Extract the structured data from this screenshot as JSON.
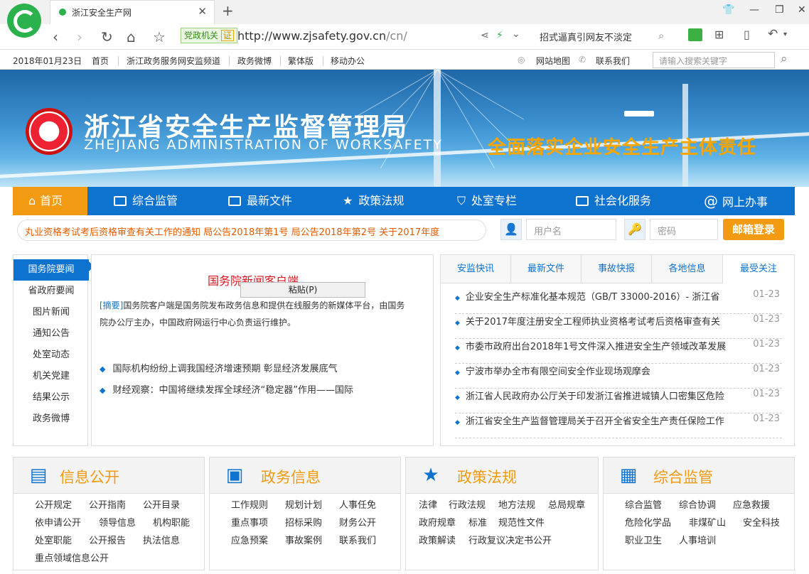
{
  "browser": {
    "tab_title": "浙江安全生产网",
    "badge": "党政机关",
    "badge_mark": "证",
    "url_main": "http://www.zjsafety.gov.cn",
    "url_rest": "/cn/",
    "hint_text": "招式逼真引网友不淡定"
  },
  "util": {
    "date": "2018年01月23日",
    "links": [
      "首页",
      "浙江政务服务网安监频道",
      "政务微博",
      "繁体版",
      "移动办公"
    ],
    "sitemap": "网站地图",
    "contact": "联系我们",
    "search_placeholder": "请输入搜索关键字"
  },
  "banner": {
    "title": "浙江省安全生产监督管理局",
    "title_en": "ZHEJIANG ADMINISTRATION OF WORKSAFETY",
    "slogan": "全面落实企业安全生产主体责任"
  },
  "nav": [
    "首页",
    "综合监管",
    "最新文件",
    "政策法规",
    "处室专栏",
    "社会化服务",
    "网上办事"
  ],
  "ticker": "丸业资格考试考后资格审查有关工作的通知   局公告2018年第1号   局公告2018年第2号   关于2017年度",
  "login": {
    "user_placeholder": "用户名",
    "pass_placeholder": "密码",
    "button": "邮箱登录"
  },
  "left_menu": [
    "国务院要闻",
    "省政府要闻",
    "图片新闻",
    "通知公告",
    "处室动态",
    "机关党建",
    "结果公示",
    "政务微博"
  ],
  "center": {
    "title": "国务院新闻客户端",
    "context_menu": "粘贴(P)",
    "abstract_tag": "[摘要]",
    "abstract": "国务院客户端是国务院发布政务信息和提供在线服务的新媒体平台，由国务院办公厅主办，中国政府网运行中心负责运行维护。",
    "items": [
      "国际机构纷纷上调我国经济增速预期 彰显经济发展底气",
      "财经观察：中国将继续发挥全球经济“稳定器”作用——国际"
    ]
  },
  "right": {
    "tabs": [
      "安监快讯",
      "最新文件",
      "事故快报",
      "各地信息",
      "最受关注"
    ],
    "items": [
      {
        "title": "企业安全生产标准化基本规范（GB/T 33000-2016）- 浙江省",
        "date": "01-23"
      },
      {
        "title": "关于2017年度注册安全工程师执业资格考试考后资格审查有关",
        "date": "01-23"
      },
      {
        "title": "市委市政府出台2018年1号文件深入推进安全生产领域改革发展",
        "date": "01-23"
      },
      {
        "title": "宁波市举办全市有限空间安全作业现场观摩会",
        "date": "01-23"
      },
      {
        "title": "浙江省人民政府办公厅关于印发浙江省推进城镇人口密集区危险",
        "date": "01-23"
      },
      {
        "title": "浙江省安全生产监督管理局关于召开全省安全生产责任保险工作",
        "date": "01-23"
      }
    ]
  },
  "sections": [
    {
      "title": "信息公开",
      "links": [
        "公开规定",
        "公开指南",
        "公开目录",
        "依申请公开",
        "领导信息",
        "机构职能",
        "处室职能",
        "公开报告",
        "执法信息",
        "重点领域信息公开"
      ]
    },
    {
      "title": "政务信息",
      "links": [
        "工作规则",
        "规划计划",
        "人事任免",
        "重点事项",
        "招标采购",
        "财务公开",
        "应急预案",
        "事故案例",
        "联系我们"
      ]
    },
    {
      "title": "政策法规",
      "links": [
        "法律",
        "行政法规",
        "地方法规",
        "总局规章",
        "政府规章",
        "标准",
        "规范性文件",
        "政策解读",
        "行政复议决定书公开"
      ]
    },
    {
      "title": "综合监管",
      "links": [
        "综合监管",
        "综合协调",
        "应急救援",
        "危险化学品",
        "非煤矿山",
        "安全科技",
        "职业卫生",
        "人事培训"
      ]
    }
  ]
}
